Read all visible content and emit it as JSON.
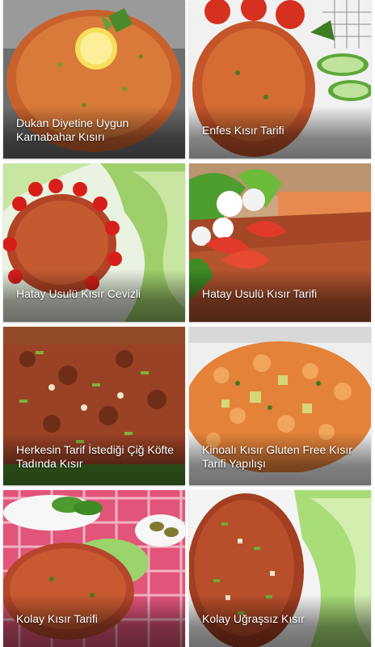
{
  "recipes": [
    {
      "title": "Dukan Diyetine Uygun Karnabahar Kısırı"
    },
    {
      "title": "Enfes Kısır Tarifi"
    },
    {
      "title": "Hatay Usulü Kısır Cevizli"
    },
    {
      "title": "Hatay Usulü Kısır Tarifi"
    },
    {
      "title": "Herkesin Tarif İstediği Çiğ Köfte Tadında Kısır"
    },
    {
      "title": "Kinoalı Kısır Gluten Free Kısır Tarifi Yapılışı"
    },
    {
      "title": "Kolay Kısır Tarifi"
    },
    {
      "title": "Kolay Uğraşsız Kısır"
    }
  ]
}
